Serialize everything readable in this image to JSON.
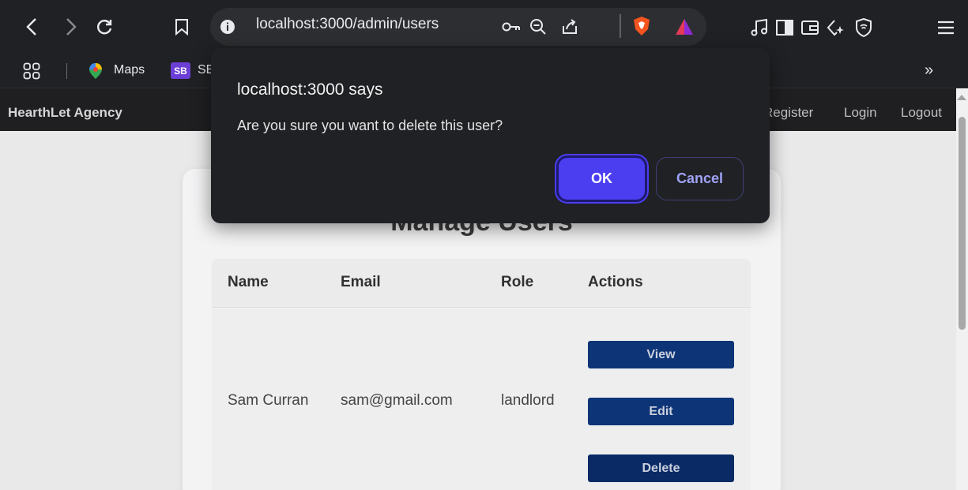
{
  "browser": {
    "url": "localhost:3000/admin/users",
    "bookmarks": [
      {
        "label": "Maps"
      },
      {
        "label": "SE"
      }
    ],
    "bookmark_badge": "SB",
    "overflow": "»"
  },
  "page": {
    "brand": "HearthLet Agency",
    "nav": [
      "Register",
      "Login",
      "Logout"
    ],
    "title": "Manage Users",
    "table": {
      "headers": [
        "Name",
        "Email",
        "Role",
        "Actions"
      ],
      "rows": [
        {
          "name": "Sam Curran",
          "email": "sam@gmail.com",
          "role": "landlord"
        }
      ],
      "actions": [
        "View",
        "Edit",
        "Delete"
      ]
    }
  },
  "dialog": {
    "title": "localhost:3000 says",
    "message": "Are you sure you want to delete this user?",
    "ok_label": "OK",
    "cancel_label": "Cancel"
  },
  "colors": {
    "accent": "#4b3df0",
    "action_button": "#0d3477",
    "navbar": "#1f1f21"
  }
}
